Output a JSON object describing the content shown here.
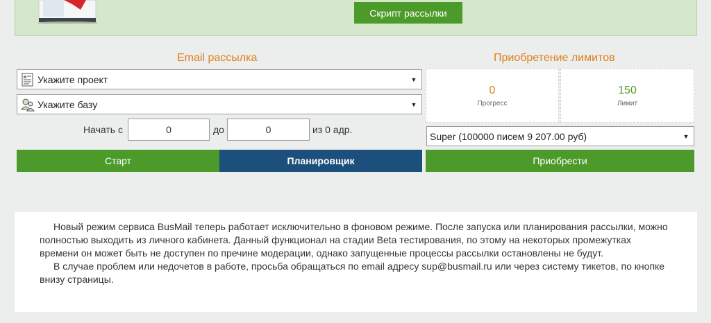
{
  "banner": {
    "script_button": "Скрипт рассылки"
  },
  "email": {
    "title": "Email рассылка",
    "project_select": "Укажите проект",
    "base_select": "Укажите базу",
    "start_label": "Начать с",
    "from_value": "0",
    "to_label": "до",
    "to_value": "0",
    "of_label": "из 0 адр.",
    "start_button": "Старт",
    "scheduler_button": "Планировщик"
  },
  "limits": {
    "title": "Приобретение лимитов",
    "progress_value": "0",
    "progress_label": "Прогресс",
    "limit_value": "150",
    "limit_label": "Лимит",
    "plan_select": "Super (100000 писем 9 207.00 руб)",
    "buy_button": "Приобрести"
  },
  "info": {
    "paragraph1": "Новый режим сервиса BusMail теперь работает исключительно в фоновом режиме. После запуска или планирования рассылки, можно полностью выходить из личного кабинета. Данный функционал на стадии Beta тестирования, по этому на некоторых промежутках времени он может быть не доступен по пречине модерации, однако запущенные процессы рассылки остановлены не будут.",
    "paragraph2": "В случае проблем или недочетов в работе, просьба обращаться по email адресу sup@busmail.ru или через систему тикетов, по кнопке внизу страницы."
  },
  "colors": {
    "accent_green": "#4c9a2a",
    "accent_blue": "#1d4f7c",
    "title_orange": "#e07f1a",
    "progress_orange": "#e07f1a",
    "limit_green": "#5a9a2a"
  }
}
